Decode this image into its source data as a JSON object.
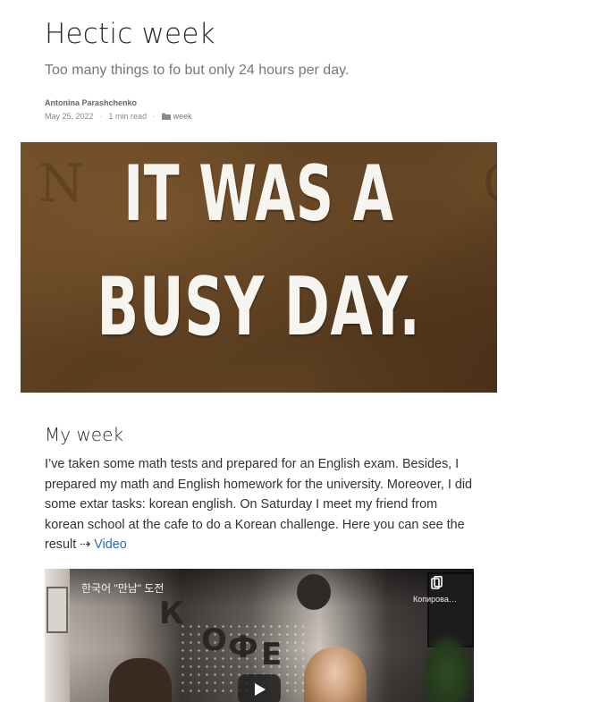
{
  "post": {
    "title": "Hectic week",
    "subtitle": "Too many things to fo but only 24 hours per day.",
    "author": "Antonina Parashchenko",
    "date": "May 25, 2022",
    "read_time": "1 min read",
    "category": "week",
    "separator": "·"
  },
  "hero": {
    "line1": "IT WAS A",
    "line2": "BUSY DAY."
  },
  "section": {
    "title": "My week",
    "text": "I’ve taken some math tests and prepared for an English exam. Besides, I prepared my math and English homework for the university. Moreover, I did some extar tasks: korean english. On Saturday I meet my friend from korean school at the cafe to do a Korean challenge. Here you can see the result ⇢ ",
    "link_label": "Video"
  },
  "video": {
    "title": "한국어 \"만남\" 도전",
    "copy_label": "Копирова…",
    "kofe_letters": [
      "К",
      "О",
      "Ф",
      "Е"
    ],
    "play_icon": "play-icon",
    "copy_icon": "copy-icon"
  },
  "icons": {
    "category_icon": "folder-icon"
  },
  "colors": {
    "link": "#2a6db5",
    "hero_text": "#f7f5f0",
    "hero_background": "#6e4d2a"
  }
}
